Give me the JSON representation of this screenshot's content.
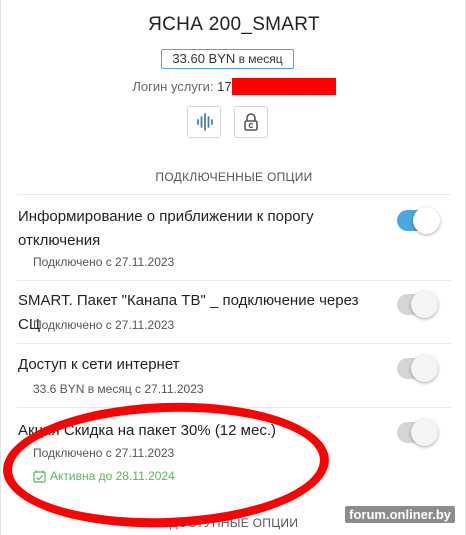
{
  "plan": {
    "title": "ЯСНА 200_SMART",
    "price_value": "33.60 BYN",
    "price_unit": " в месяц",
    "login_label": "Логин услуги: ",
    "login_value": "17"
  },
  "icons": {
    "voice": "audio-wave-icon",
    "lock": "lock-icon"
  },
  "sections": {
    "connected_title": "ПОДКЛЮЧЕННЫЕ ОПЦИИ",
    "available_title": "ДОСТУПНЫЕ ОПЦИИ"
  },
  "options": [
    {
      "name": "Информирование о приближении к порогу отключения",
      "sub": "Подключено с 27.11.2023",
      "enabled": true
    },
    {
      "name": "SMART. Пакет \"Канапа ТВ\" _ подключение через СЦ",
      "sub": "Подключено с 27.11.2023",
      "enabled": false
    },
    {
      "name": "Доступ к сети интернет",
      "sub": "33.6 BYN в месяц с 27.11.2023",
      "enabled": false
    },
    {
      "name": "Акция Скидка на пакет 30% (12 мес.)",
      "sub": "Подключено с 27.11.2023",
      "active_until": "Активна до 28.11.2024",
      "enabled": false
    }
  ],
  "watermark": "forum.onliner.by",
  "colors": {
    "accent": "#4aa8e0",
    "active_green": "#5bb55b",
    "annotation_red": "#ff0000"
  }
}
